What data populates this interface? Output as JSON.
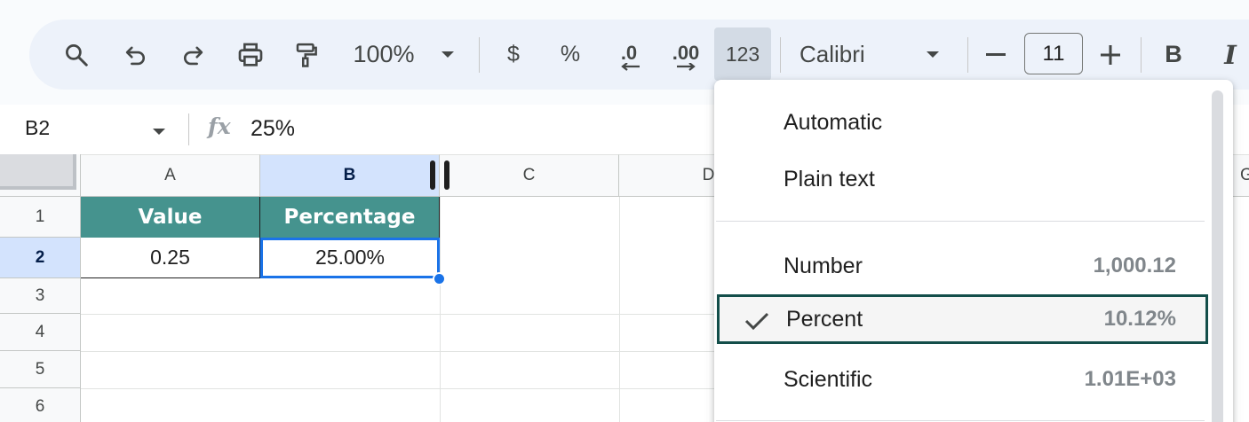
{
  "toolbar": {
    "zoom": "100%",
    "currency_symbol": "$",
    "percent_symbol": "%",
    "decrease_decimal": ".0",
    "increase_decimal": ".00",
    "more_formats_label": "123",
    "font_family": "Calibri",
    "font_size": "11",
    "bold_label": "B",
    "italic_label": "I"
  },
  "formula_bar": {
    "cell_reference": "B2",
    "fx_label": "fx",
    "value": "25%"
  },
  "grid": {
    "columns": [
      "A",
      "B",
      "C",
      "D",
      "G"
    ],
    "rows": [
      "1",
      "2",
      "3",
      "4",
      "5",
      "6"
    ],
    "header_row": [
      "Value",
      "Percentage"
    ],
    "data_row": [
      "0.25",
      "25.00%"
    ]
  },
  "format_menu": {
    "items": [
      {
        "label": "Automatic",
        "example": ""
      },
      {
        "label": "Plain text",
        "example": ""
      },
      {
        "label": "Number",
        "example": "1,000.12"
      },
      {
        "label": "Percent",
        "example": "10.12%",
        "checked": true
      },
      {
        "label": "Scientific",
        "example": "1.01E+03"
      }
    ]
  },
  "colors": {
    "header_fill": "#45938e",
    "selection": "#1a73e8",
    "toolbar_bg": "#edf2fa",
    "checked_border": "#134e4a"
  }
}
